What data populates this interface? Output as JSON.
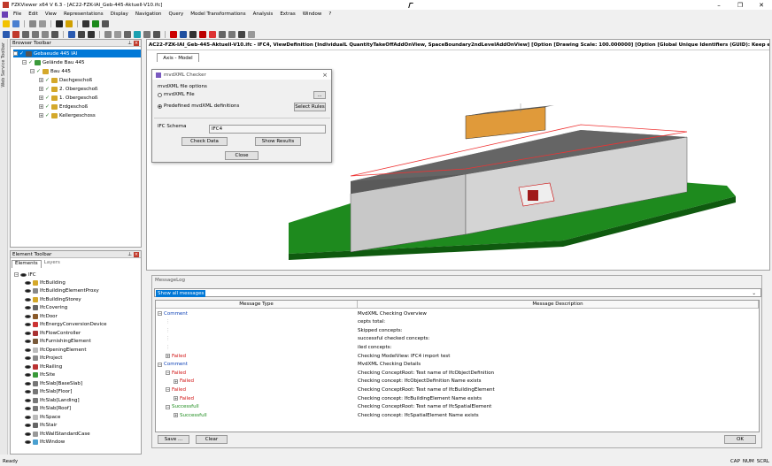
{
  "window": {
    "title": "FZKViewer x64 V 6.3 - [AC22-FZK-IAI_Geb-445-Aktuell-V10.ifc]",
    "buttons": [
      "–",
      "❐",
      "✕"
    ]
  },
  "menu": [
    "File",
    "Edit",
    "View",
    "Representations",
    "Display",
    "Navigation",
    "Query",
    "Model Transformations",
    "Analysis",
    "Extras",
    "Window",
    "?"
  ],
  "web_service_toolbar": "Web Service Toolbar",
  "browser_toolbar": {
    "title": "Browser Toolbar",
    "items": [
      {
        "label": "Gebaeude 445 IAI",
        "selected": true
      },
      {
        "label": "Gelände Bau 445"
      },
      {
        "label": "Bau 445"
      },
      {
        "label": "Dachgeschoß"
      },
      {
        "label": "2. Obergeschoß"
      },
      {
        "label": "1. Obergeschoß"
      },
      {
        "label": "Erdgeschoß"
      },
      {
        "label": "Kellergeschoss"
      }
    ]
  },
  "element_toolbar": {
    "title": "Element Toolbar",
    "tabs": [
      "Elements",
      "Layers"
    ],
    "root": "IFC",
    "items": [
      "IfcBuilding",
      "IfcBuildingElementProxy",
      "IfcBuildingStorey",
      "IfcCovering",
      "IfcDoor",
      "IfcEnergyConversionDevice",
      "IfcFlowController",
      "IfcFurnishingElement",
      "IfcOpeningElement",
      "IfcProject",
      "IfcRailing",
      "IfcSite",
      "IfcSlab[BaseSlab]",
      "IfcSlab[Floor]",
      "IfcSlab[Landing]",
      "IfcSlab[Roof]",
      "IfcSpace",
      "IfcStair",
      "IfcWallStandardCase",
      "IfcWindow"
    ]
  },
  "viewport": {
    "header": "AC22-FZK-IAI_Geb-445-Aktuell-V10.ifc - IFC4, ViewDefinition [IndividualL QuantityTakeOffAddOnView, SpaceBoundary2ndLevelAddOnView] [Option [Drawing Scale: 100.000000] [Option [Global Unique Identifiers (GUID): Keep existing] [Option [Elements to export: Entire project] [Option [Partial S",
    "tab": "Axis - Model"
  },
  "mvdxml_dialog": {
    "title": "mvdXML Checker",
    "group_label": "mvdXML file options",
    "option_file": "mvdXML File",
    "file_browse": "...",
    "option_predefined": "Predefined mvdXML definitions",
    "select_rules": "Select Rules",
    "schema_label": "IFC Schema",
    "schema_value": "IFC4",
    "check_data": "Check Data",
    "show_results": "Show Results",
    "close": "Close"
  },
  "message_log": {
    "title": "MessageLog",
    "filter": "Show all messages",
    "col_type": "Message Type",
    "col_desc": "Message Description",
    "rows": [
      {
        "type": "Comment",
        "desc": "MvdXML Checking Overview",
        "cls": "comment",
        "indent": 0,
        "exp": "−"
      },
      {
        "type": "",
        "desc": "cepts total:",
        "cls": "",
        "indent": 1,
        "exp": ""
      },
      {
        "type": "",
        "desc": "Skipped concepts:",
        "cls": "",
        "indent": 1,
        "exp": ""
      },
      {
        "type": "",
        "desc": "successful checked concepts:",
        "cls": "",
        "indent": 1,
        "exp": ""
      },
      {
        "type": "",
        "desc": "iled concepts:",
        "cls": "",
        "indent": 1,
        "exp": ""
      },
      {
        "type": "Failed",
        "desc": "Checking ModelView: IFC4 import test",
        "cls": "failed",
        "indent": 1,
        "exp": "+"
      },
      {
        "type": "Comment",
        "desc": "MvdXML Checking Details",
        "cls": "comment",
        "indent": 0,
        "exp": "−"
      },
      {
        "type": "Failed",
        "desc": "Checking ConceptRoot: Test name of IfcObjectDefinition",
        "cls": "failed",
        "indent": 1,
        "exp": "−"
      },
      {
        "type": "Failed",
        "desc": "Checking concept: IfcObjectDefinition Name exists",
        "cls": "failed",
        "indent": 2,
        "exp": "+"
      },
      {
        "type": "Failed",
        "desc": "Checking ConceptRoot: Test name of IfcBuildingElement",
        "cls": "failed",
        "indent": 1,
        "exp": "−"
      },
      {
        "type": "Failed",
        "desc": "Checking concept: IfcBuildingElement Name exists",
        "cls": "failed",
        "indent": 2,
        "exp": "+"
      },
      {
        "type": "Successfull",
        "desc": "Checking ConceptRoot: Test name of IfcSpatialElement",
        "cls": "success",
        "indent": 1,
        "exp": "−"
      },
      {
        "type": "Successfull",
        "desc": "Checking concept: IfcSpatialElement Name exists",
        "cls": "success",
        "indent": 2,
        "exp": "+"
      }
    ],
    "save": "Save ...",
    "clear": "Clear",
    "ok": "OK"
  },
  "status": {
    "left": "Ready",
    "right": [
      "CAP",
      "NUM",
      "SCRL"
    ]
  }
}
